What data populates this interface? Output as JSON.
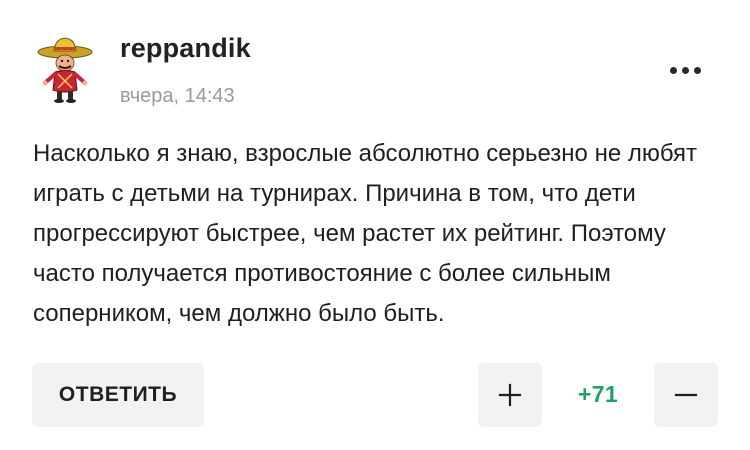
{
  "comment": {
    "username": "reppandik",
    "timestamp": "вчера, 14:43",
    "text": "Насколько я знаю, взрослые абсолютно серьезно не любят играть с детьми на турнирах. Причина в том, что дети прогрессируют быстрее, чем растет их рейтинг. Поэтому часто получается противостояние с более сильным соперником, чем должно было быть.",
    "more_icon": "more-dots-icon",
    "avatar_icon": "sombrero-character-avatar"
  },
  "actions": {
    "reply_label": "ОТВЕТИТЬ",
    "upvote_icon": "plus-icon",
    "downvote_icon": "minus-icon",
    "rating": "+71"
  },
  "colors": {
    "rating_positive": "#1ea362",
    "button_bg": "#f2f2f2",
    "timestamp": "#9a9a9a"
  }
}
